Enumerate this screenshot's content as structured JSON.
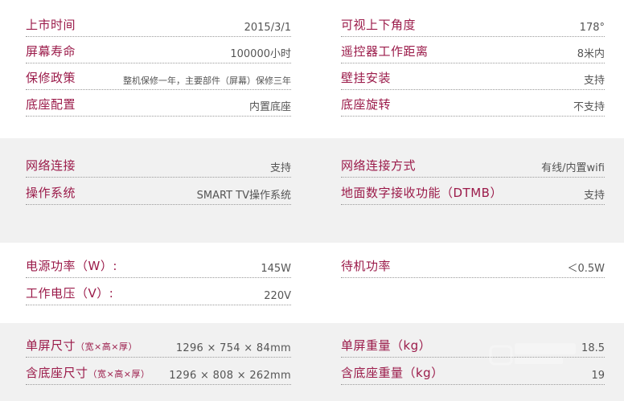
{
  "sections": {
    "basic": {
      "left": [
        {
          "label": "上市时间",
          "value": "2015/3/1"
        },
        {
          "label": "屏幕寿命",
          "value": "100000小时"
        },
        {
          "label": "保修政策",
          "value": "整机保修一年，主要部件（屏幕）保修三年"
        },
        {
          "label": "底座配置",
          "value": "内置底座"
        }
      ],
      "right": [
        {
          "label": "可视上下角度",
          "value": "178°"
        },
        {
          "label": "遥控器工作距离",
          "value": "8米内"
        },
        {
          "label": "壁挂安装",
          "value": "支持"
        },
        {
          "label": "底座旋转",
          "value": "不支持"
        }
      ]
    },
    "network": {
      "left": [
        {
          "label": "网络连接",
          "value": "支持"
        },
        {
          "label": "操作系统",
          "value": "SMART TV操作系统"
        }
      ],
      "right": [
        {
          "label": "网络连接方式",
          "value": "有线/内置wifi"
        },
        {
          "label": "地面数字接收功能（DTMB）",
          "value": "支持"
        }
      ]
    },
    "power": {
      "left": [
        {
          "label": "电源功率（W）:",
          "value": "145W"
        },
        {
          "label": "工作电压（V）:",
          "value": "220V"
        }
      ],
      "right": [
        {
          "label": "待机功率",
          "value": "＜0.5W"
        }
      ]
    },
    "size": {
      "left": [
        {
          "label": "单屏尺寸",
          "label_note": "（宽×高×厚）",
          "value": "1296 × 754 × 84mm"
        },
        {
          "label": "含底座尺寸",
          "label_note": "（宽×高×厚）",
          "value": "1296 × 808 × 262mm"
        }
      ],
      "right": [
        {
          "label": "单屏重量（kg）",
          "value": "18.5"
        },
        {
          "label": "含底座重量（kg）",
          "value": "19"
        }
      ]
    }
  }
}
